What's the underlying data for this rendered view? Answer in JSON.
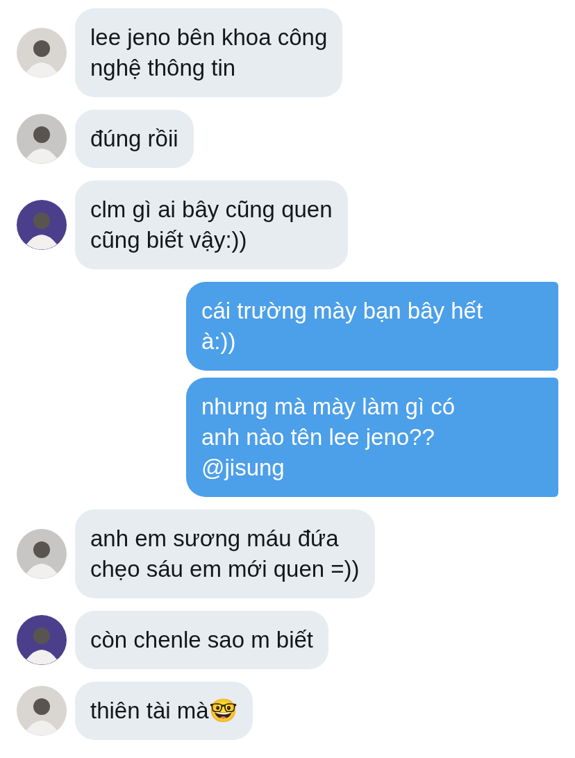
{
  "messages": [
    {
      "kind": "incoming",
      "avatar": {
        "color": "#d9d6d2"
      },
      "text": "lee jeno bên khoa công\nnghệ thông tin"
    },
    {
      "kind": "incoming",
      "avatar": {
        "color": "#c8c6c4"
      },
      "text": "đúng rồii"
    },
    {
      "kind": "incoming",
      "avatar": {
        "color": "#4b3f8c"
      },
      "text": "clm gì ai bây cũng quen\ncũng biết vậy:))"
    },
    {
      "kind": "outgoing",
      "text": "cái trường mày bạn bây hết\nà:))"
    },
    {
      "kind": "outgoing",
      "text": "nhưng mà mày làm gì có\nanh nào tên lee jeno??\n@jisung"
    },
    {
      "kind": "incoming",
      "avatar": {
        "color": "#c8c6c4"
      },
      "text": "anh em sương máu đứa\nchẹo sáu em mới quen =))"
    },
    {
      "kind": "incoming",
      "avatar": {
        "color": "#4b3f8c"
      },
      "text": "còn chenle sao m biết"
    },
    {
      "kind": "incoming",
      "avatar": {
        "color": "#d9d6d2"
      },
      "text": "thiên tài mà🤓"
    }
  ]
}
